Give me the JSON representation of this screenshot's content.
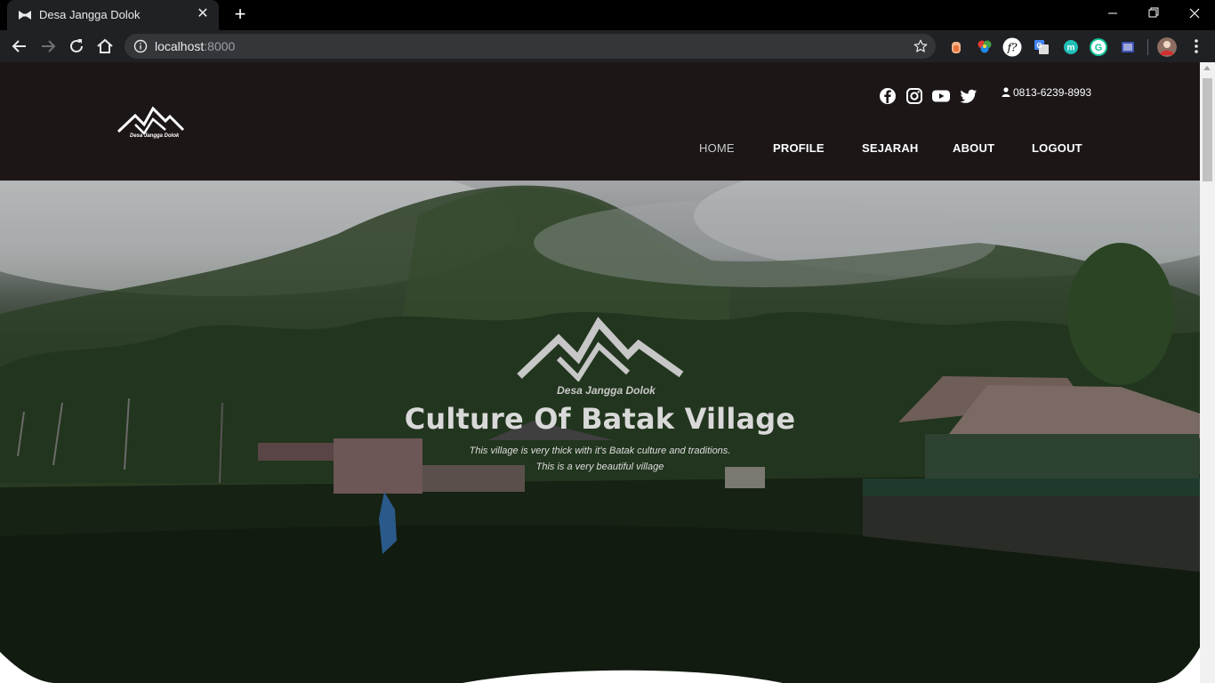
{
  "browser": {
    "tab_title": "Desa Jangga Dolok",
    "url_host": "localhost",
    "url_port": ":8000"
  },
  "site": {
    "logo_text": "Desa Jangga Dolok",
    "phone": "0813-6239-8993",
    "social": [
      "facebook-icon",
      "instagram-icon",
      "youtube-icon",
      "twitter-icon"
    ],
    "menu": [
      {
        "label": "HOME",
        "active": true
      },
      {
        "label": "PROFILE",
        "active": false
      },
      {
        "label": "SEJARAH",
        "active": false
      },
      {
        "label": "ABOUT",
        "active": false
      },
      {
        "label": "LOGOUT",
        "active": false
      }
    ]
  },
  "hero": {
    "logo_text": "Desa Jangga Dolok",
    "title": "Culture Of Batak Village",
    "subtitle_line1": "This village is very thick with it's Batak culture and traditions.",
    "subtitle_line2": "This is a very beautiful village"
  },
  "colors": {
    "header_bg": "#1c1617",
    "browser_bg": "#202124",
    "hero_text": "#d9d9d9"
  }
}
